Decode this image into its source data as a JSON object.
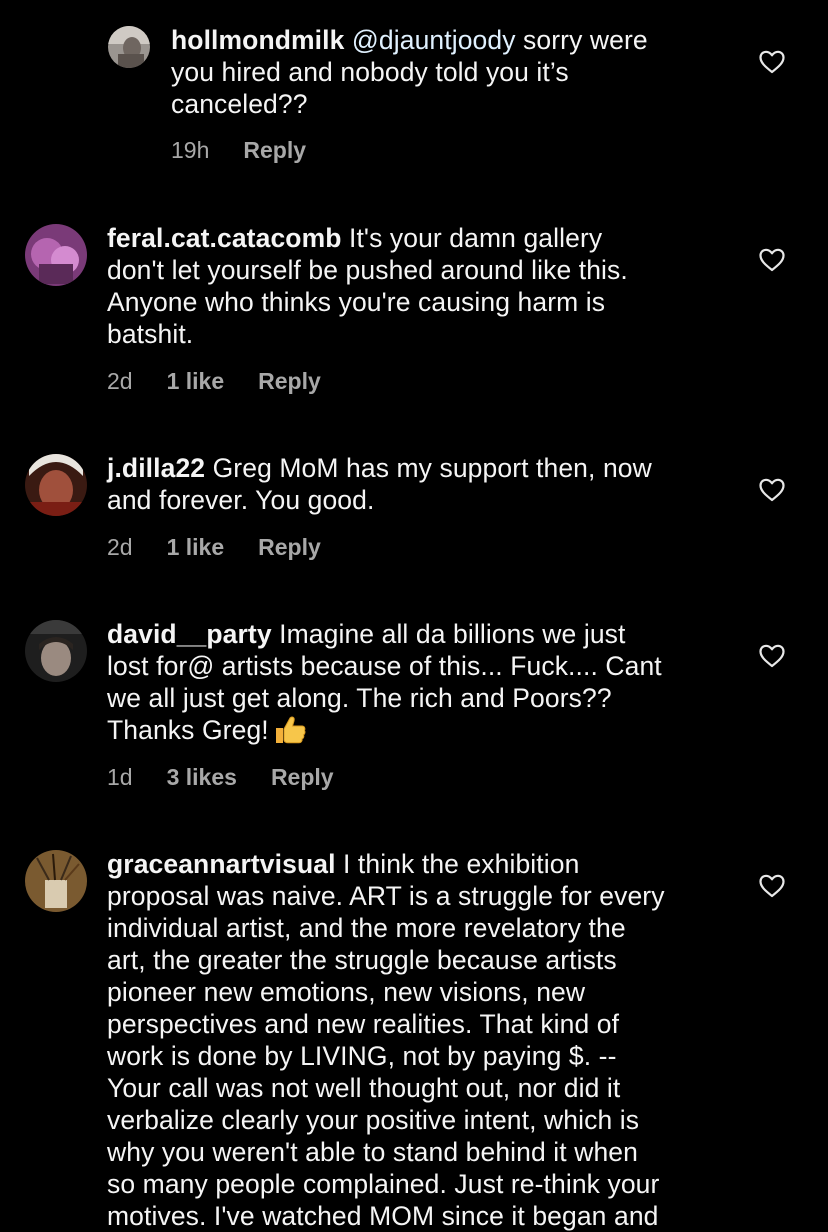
{
  "comments": [
    {
      "username": "hollmondmilk",
      "mention": "@djauntjoody",
      "lines": [
        " sorry were",
        "you hired and nobody told you it’s",
        "canceled??"
      ],
      "time": "19h",
      "likes": "",
      "reply": "Reply",
      "avatar_icon": "user-avatar-photo",
      "heart_icon": "heart-outline-icon"
    },
    {
      "username": "feral.cat.catacomb",
      "lines": [
        " It's your damn gallery",
        "don't let yourself be pushed around like this.",
        "Anyone who thinks you're causing harm is",
        "batshit."
      ],
      "time": "2d",
      "likes": "1 like",
      "reply": "Reply",
      "avatar_icon": "user-avatar-photo",
      "heart_icon": "heart-outline-icon"
    },
    {
      "username": "j.dilla22",
      "lines": [
        " Greg MoM has my support then, now",
        "and forever.  You good."
      ],
      "time": "2d",
      "likes": "1 like",
      "reply": "Reply",
      "avatar_icon": "user-avatar-photo",
      "heart_icon": "heart-outline-icon"
    },
    {
      "username": "david__party",
      "lines": [
        " Imagine all da billions we just",
        "lost for@ artists because of this... Fuck.... Cant",
        "we all just get along. The rich and Poors??",
        "Thanks Greg!"
      ],
      "emoji": "thumbs-up-emoji",
      "time": "1d",
      "likes": "3 likes",
      "reply": "Reply",
      "avatar_icon": "user-avatar-photo",
      "heart_icon": "heart-outline-icon"
    },
    {
      "username": "graceannartvisual",
      "lines": [
        " I think the exhibition",
        "proposal was naive. ART is a struggle for every",
        "individual artist, and the more revelatory the",
        "art, the greater the struggle because artists",
        "pioneer new emotions, new visions, new",
        "perspectives and new realities. That kind of",
        "work is done by LIVING, not by paying $. --",
        "Your call was not well thought out, nor did it",
        "verbalize clearly your positive intent, which is",
        "why you weren't able to stand behind it when",
        "so many people complained. Just re-think your",
        "motives. I've watched MOM since it began and"
      ],
      "avatar_icon": "user-avatar-photo",
      "heart_icon": "heart-outline-icon"
    }
  ],
  "colors": {
    "background": "#000000",
    "text": "#f5f5f5",
    "meta": "#a8a8a8",
    "mention": "#e0f1ff"
  }
}
